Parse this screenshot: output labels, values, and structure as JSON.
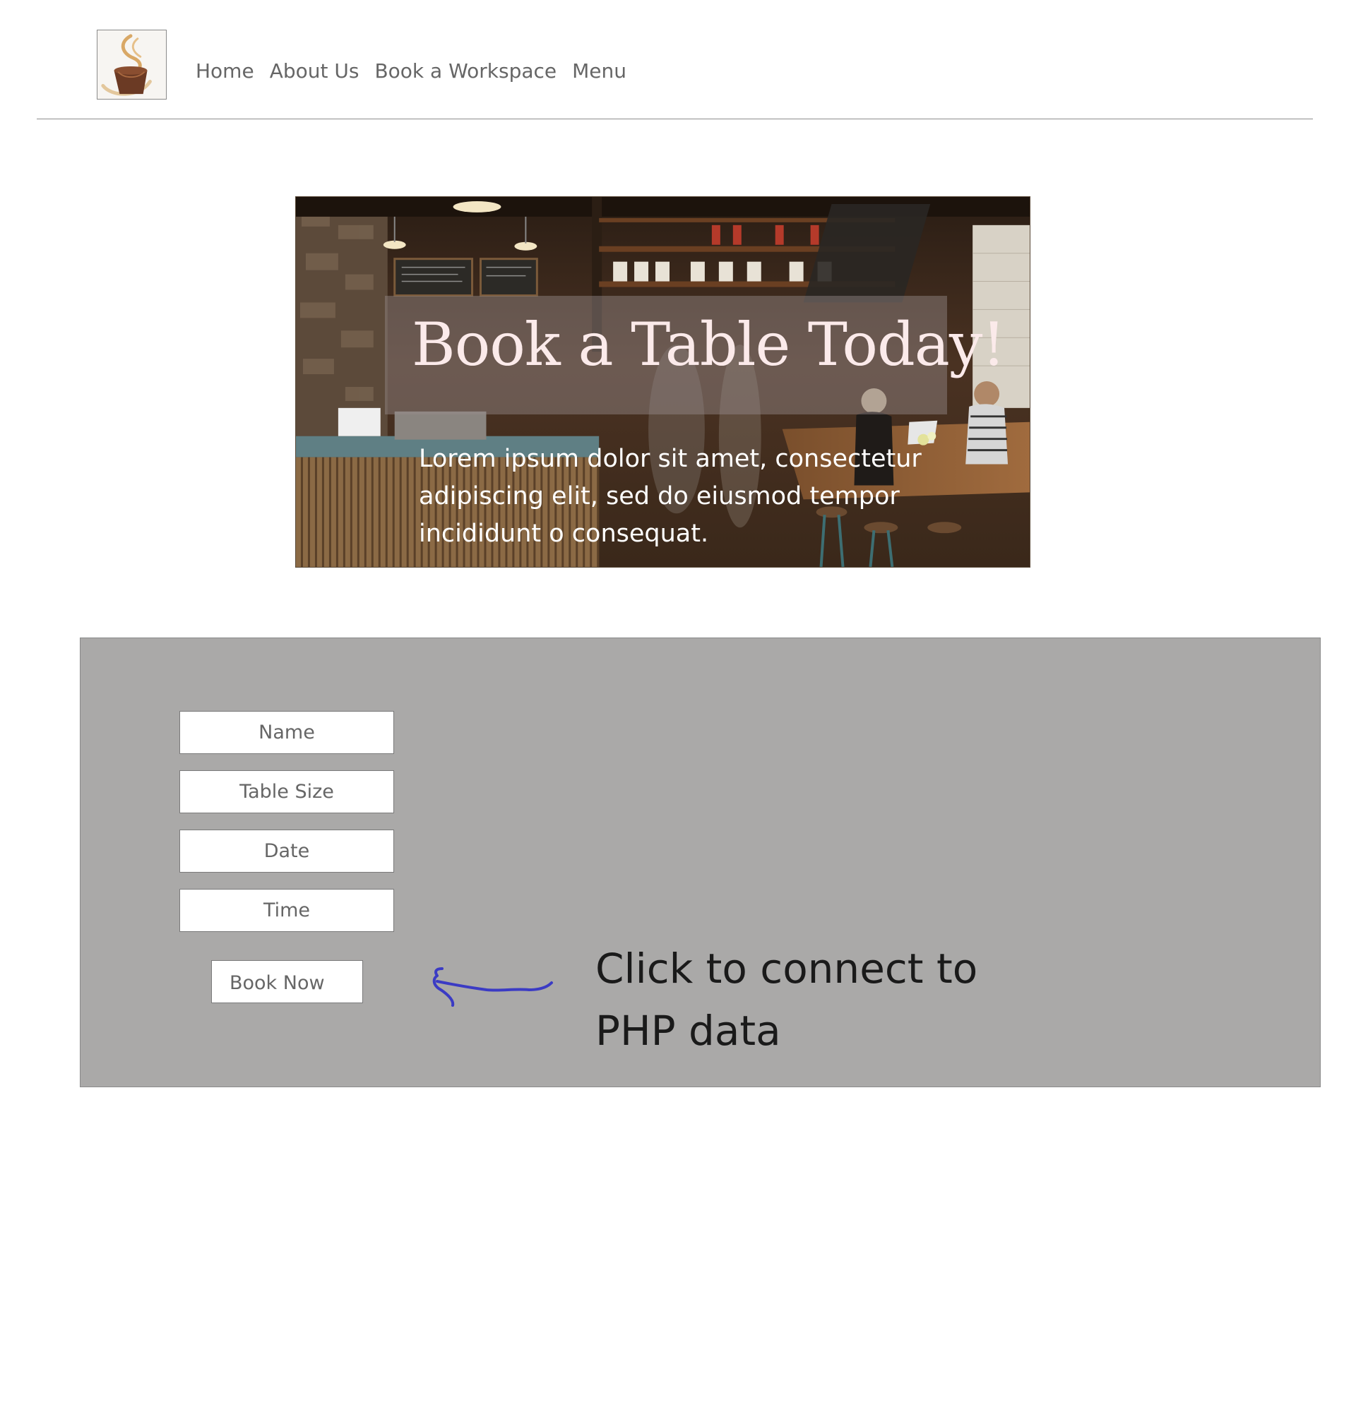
{
  "header": {
    "logo": {
      "icon": "coffee-cup-icon"
    },
    "nav": [
      {
        "label": "Home"
      },
      {
        "label": "About Us"
      },
      {
        "label": "Book a Workspace"
      },
      {
        "label": "Menu"
      }
    ]
  },
  "hero": {
    "title": "Book a Table Today!",
    "body": "Lorem ipsum dolor sit amet, consectetur adipiscing elit, sed do eiusmod tempor incididunt o consequat."
  },
  "booking_form": {
    "fields": [
      {
        "placeholder": "Name",
        "value": ""
      },
      {
        "placeholder": "Table Size",
        "value": ""
      },
      {
        "placeholder": "Date",
        "value": ""
      },
      {
        "placeholder": "Time",
        "value": ""
      }
    ],
    "submit_label": "Book Now"
  },
  "annotation": {
    "text": "Click to connect to\nPHP data",
    "arrow_color": "#3b3bc4"
  },
  "colors": {
    "panel_bg": "#aaa9a8",
    "nav_text": "#666666",
    "hero_title": "#fbeaea"
  }
}
